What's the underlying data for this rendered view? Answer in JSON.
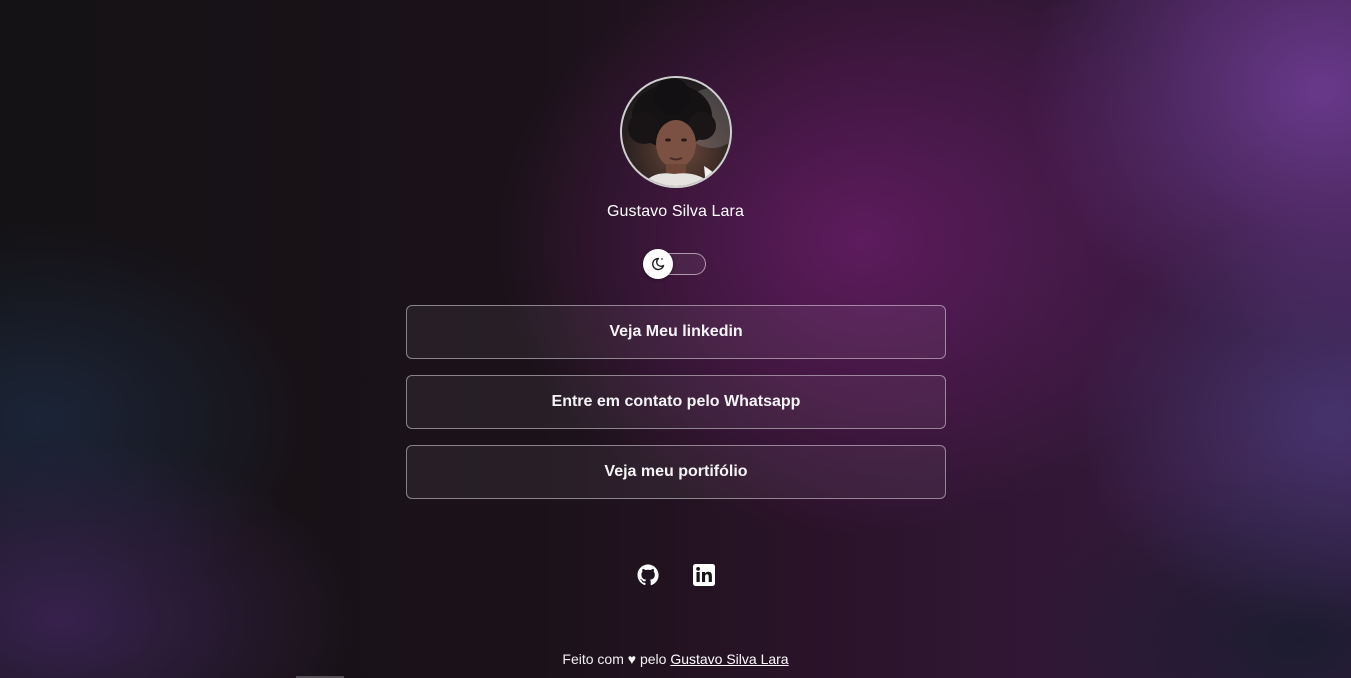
{
  "profile": {
    "name": "Gustavo Silva Lara",
    "avatar_alt": "avatar"
  },
  "theme_toggle": {
    "icon": "moon-icon",
    "state": "dark"
  },
  "links": [
    {
      "label": "Veja Meu linkedin"
    },
    {
      "label": "Entre em contato pelo Whatsapp"
    },
    {
      "label": "Veja meu portifólio"
    }
  ],
  "social": [
    {
      "icon": "github-icon"
    },
    {
      "icon": "linkedin-icon"
    }
  ],
  "footer": {
    "prefix": "Feito com ♥ pelo",
    "author_link": "Gustavo Silva Lara"
  },
  "colors": {
    "text": "#ffffff",
    "button_border": "#ffffff73",
    "accent_purple": "#6e1e6e"
  }
}
